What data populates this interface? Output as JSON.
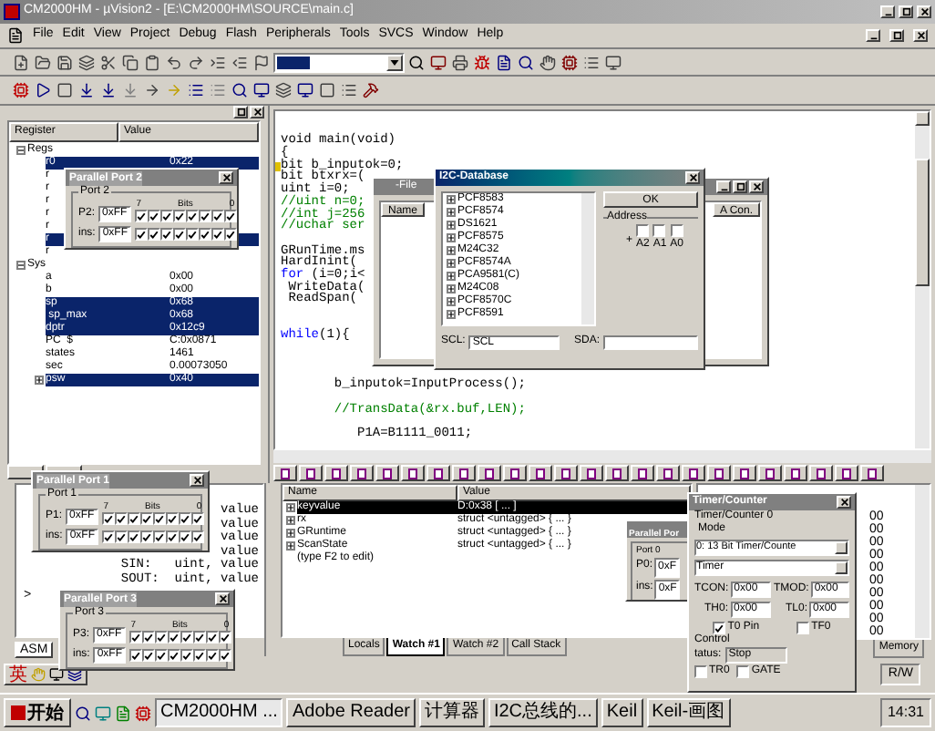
{
  "window": {
    "title": "CM2000HM - µVision2 - [E:\\CM2000HM\\SOURCE\\main.c]"
  },
  "menu": [
    "File",
    "Edit",
    "View",
    "Project",
    "Debug",
    "Flash",
    "Peripherals",
    "Tools",
    "SVCS",
    "Window",
    "Help"
  ],
  "registers": {
    "columns": [
      "Register",
      "Value"
    ],
    "groups": [
      {
        "name": "Regs",
        "expanded": true,
        "children": [
          {
            "name": "r0",
            "value": "0x22",
            "selected": true
          },
          {
            "name": "r",
            "selected": false
          },
          {
            "name": "r",
            "selected": false
          },
          {
            "name": "r",
            "selected": false
          },
          {
            "name": "r",
            "selected": false
          },
          {
            "name": "r",
            "selected": false
          },
          {
            "name": "r",
            "selected": true
          },
          {
            "name": "r",
            "selected": false
          }
        ]
      },
      {
        "name": "Sys",
        "expanded": true,
        "children": [
          {
            "name": "a",
            "value": "0x00",
            "selected": false
          },
          {
            "name": "b",
            "value": "0x00",
            "selected": false
          },
          {
            "name": "sp",
            "value": "0x68",
            "selected": true
          },
          {
            "name": " sp_max",
            "value": "0x68",
            "selected": true
          },
          {
            "name": "dptr",
            "value": "0x12c9",
            "selected": true
          },
          {
            "name": "PC  $",
            "value": "C:0x0871",
            "selected": false
          },
          {
            "name": "states",
            "value": "1461",
            "selected": false
          },
          {
            "name": "sec",
            "value": "0.00073050",
            "selected": false
          },
          {
            "name": "psw",
            "value": "0x40",
            "selected": true,
            "expanded": false
          }
        ]
      }
    ]
  },
  "editor": {
    "lines": [
      {
        "kind": "blank",
        "current": false
      },
      {
        "kind": "blank",
        "current": false
      },
      {
        "kind": "code",
        "text": "void main(void)",
        "current": false
      },
      {
        "kind": "code",
        "text": "{",
        "current": false
      },
      {
        "kind": "code",
        "text": "bit b_inputok=0;",
        "current": true
      },
      {
        "kind": "code",
        "text": "bit btxrx=(",
        "current": false
      },
      {
        "kind": "code",
        "text": "uint i=0;",
        "current": false
      },
      {
        "kind": "comment",
        "text": "//uint n=0;",
        "current": false
      },
      {
        "kind": "comment",
        "text": "//int j=256",
        "current": false
      },
      {
        "kind": "comment",
        "text": "//uchar ser",
        "current": false
      },
      {
        "kind": "blank",
        "current": false
      },
      {
        "kind": "code",
        "text": "GRunTime.ms",
        "current": false
      },
      {
        "kind": "code",
        "text": "HardInint(",
        "current": false
      },
      {
        "kind": "code",
        "keyword": "for",
        "text": " (i=0;i<",
        "current": false
      },
      {
        "kind": "code",
        "text": " WriteData(",
        "current": false
      },
      {
        "kind": "code",
        "text": " ReadSpan(",
        "current": false
      },
      {
        "kind": "blank",
        "current": false
      },
      {
        "kind": "blank",
        "current": false
      },
      {
        "kind": "code",
        "keyword": "while",
        "text": "(1){",
        "current": false
      },
      {
        "kind": "blank",
        "current": false
      },
      {
        "kind": "blank",
        "current": false
      },
      {
        "kind": "blank",
        "current": false
      },
      {
        "kind": "code",
        "text": "       b_inputok=InputProcess();",
        "current": false
      },
      {
        "kind": "blank",
        "current": false
      },
      {
        "kind": "comment",
        "text": "       //TransData(&rx.buf,LEN);",
        "current": false
      },
      {
        "kind": "blank",
        "current": false
      },
      {
        "kind": "code",
        "text": "          P1A=B1111_0011;",
        "current": false
      }
    ]
  },
  "file_window": {
    "title": "-File",
    "columns": [
      "Name",
      "A Con."
    ]
  },
  "i2c_database": {
    "title": "I2C-Database",
    "devices": [
      "PCF8583",
      "PCF8574",
      "DS1621",
      "PCF8575",
      "M24C32",
      "PCF8574A",
      "PCA9581(C)",
      "M24C08",
      "PCF8570C",
      "PCF8591"
    ],
    "ok": "OK",
    "address_label": "Address",
    "address_prefix": "+",
    "address_bits": [
      {
        "label": "A2",
        "checked": false
      },
      {
        "label": "A1",
        "checked": false
      },
      {
        "label": "A0",
        "checked": false
      }
    ],
    "scl_label": "SCL:",
    "scl_value": "SCL",
    "sda_label": "SDA:"
  },
  "ports": [
    {
      "title": "Parallel Port 2",
      "group": "Port 2",
      "label": "P2:",
      "value": "0xFF",
      "bit_high": "7",
      "bits_label": "Bits",
      "bit_low": "0",
      "pins_label": "ins:",
      "pins_value": "0xFF",
      "bits": [
        true,
        true,
        true,
        true,
        true,
        true,
        true,
        true
      ],
      "pins": [
        true,
        true,
        true,
        true,
        true,
        true,
        true,
        true
      ]
    },
    {
      "title": "Parallel Port 1",
      "group": "Port 1",
      "label": "P1:",
      "value": "0xFF",
      "bit_high": "7",
      "bits_label": "Bits",
      "bit_low": "0",
      "pins_label": "ins:",
      "pins_value": "0xFF",
      "bits": [
        true,
        true,
        true,
        true,
        true,
        true,
        true,
        true
      ],
      "pins": [
        true,
        true,
        true,
        true,
        true,
        true,
        true,
        true
      ]
    },
    {
      "title": "Parallel Port 3",
      "group": "Port 3",
      "label": "P3:",
      "value": "0xFF",
      "bit_high": "7",
      "bits_label": "Bits",
      "bit_low": "0",
      "pins_label": "ins:",
      "pins_value": "0xFF",
      "bits": [
        true,
        true,
        true,
        true,
        true,
        true,
        true,
        true
      ],
      "pins": [
        true,
        true,
        true,
        true,
        true,
        true,
        true,
        true
      ]
    }
  ],
  "port0": {
    "title": "Parallel Por",
    "group": "Port 0",
    "label": "P0:",
    "value": "0xF",
    "pins_label": "ins:",
    "pins_value": "0xF"
  },
  "output": {
    "lines": [
      "value",
      "value",
      "value",
      "value",
      "SIN:   uint, value",
      "SOUT:  uint, value"
    ],
    "prompt": ">",
    "tab": "ASM"
  },
  "watch": {
    "columns": [
      "Name",
      "Value"
    ],
    "rows": [
      {
        "name": "keyvalue",
        "value": "D:0x38 [ ... ]",
        "selected": true,
        "expanded": false
      },
      {
        "name": "rx",
        "value": "struct <untagged> { ... }",
        "selected": false,
        "expanded": false
      },
      {
        "name": "GRuntime",
        "value": "struct <untagged> { ... }",
        "selected": false,
        "expanded": false
      },
      {
        "name": "ScanState",
        "value": "struct <untagged> { ... }",
        "selected": false,
        "expanded": false
      },
      {
        "name": "(type F2 to edit)",
        "selected": false
      }
    ],
    "tabs": [
      {
        "label": "Locals",
        "selected": false
      },
      {
        "label": "Watch #1",
        "selected": true
      },
      {
        "label": "Watch #2",
        "selected": false
      },
      {
        "label": "Call Stack",
        "selected": false
      }
    ]
  },
  "memory": {
    "values": [
      "00",
      "00",
      "00",
      "00",
      "00",
      "00",
      "00",
      "00",
      "00",
      "00"
    ],
    "tab": "Memory"
  },
  "timer": {
    "title": "Timer/Counter",
    "group": "Timer/Counter 0",
    "mode_label": "Mode",
    "mode": "0: 13 Bit Timer/Counte",
    "type": "Timer",
    "fields": [
      {
        "label": "TCON:",
        "value": "0x00"
      },
      {
        "label": "TMOD:",
        "value": "0x00"
      },
      {
        "label": "TH0:",
        "value": "0x00"
      },
      {
        "label": "TL0:",
        "value": "0x00"
      }
    ],
    "checks": [
      {
        "label": "T0 Pin",
        "checked": true
      },
      {
        "label": "TF0",
        "checked": false
      }
    ],
    "control_label": "Control",
    "status_label": "tatus:",
    "status": "Stop",
    "control_checks": [
      {
        "label": "TR0",
        "checked": false
      },
      {
        "label": "GATE",
        "checked": false
      }
    ]
  },
  "status_bar": {
    "ime": "英",
    "mode": "R/W"
  },
  "taskbar": {
    "start": "开始",
    "tasks": [
      {
        "label": "CM2000HM ...",
        "selected": true
      },
      {
        "label": "Adobe Reader",
        "selected": false
      },
      {
        "label": "计算器",
        "selected": false
      },
      {
        "label": "I2C总线的...",
        "selected": false
      },
      {
        "label": "Keil",
        "selected": false
      },
      {
        "label": "Keil-画图",
        "selected": false
      }
    ],
    "clock": "14:31"
  }
}
